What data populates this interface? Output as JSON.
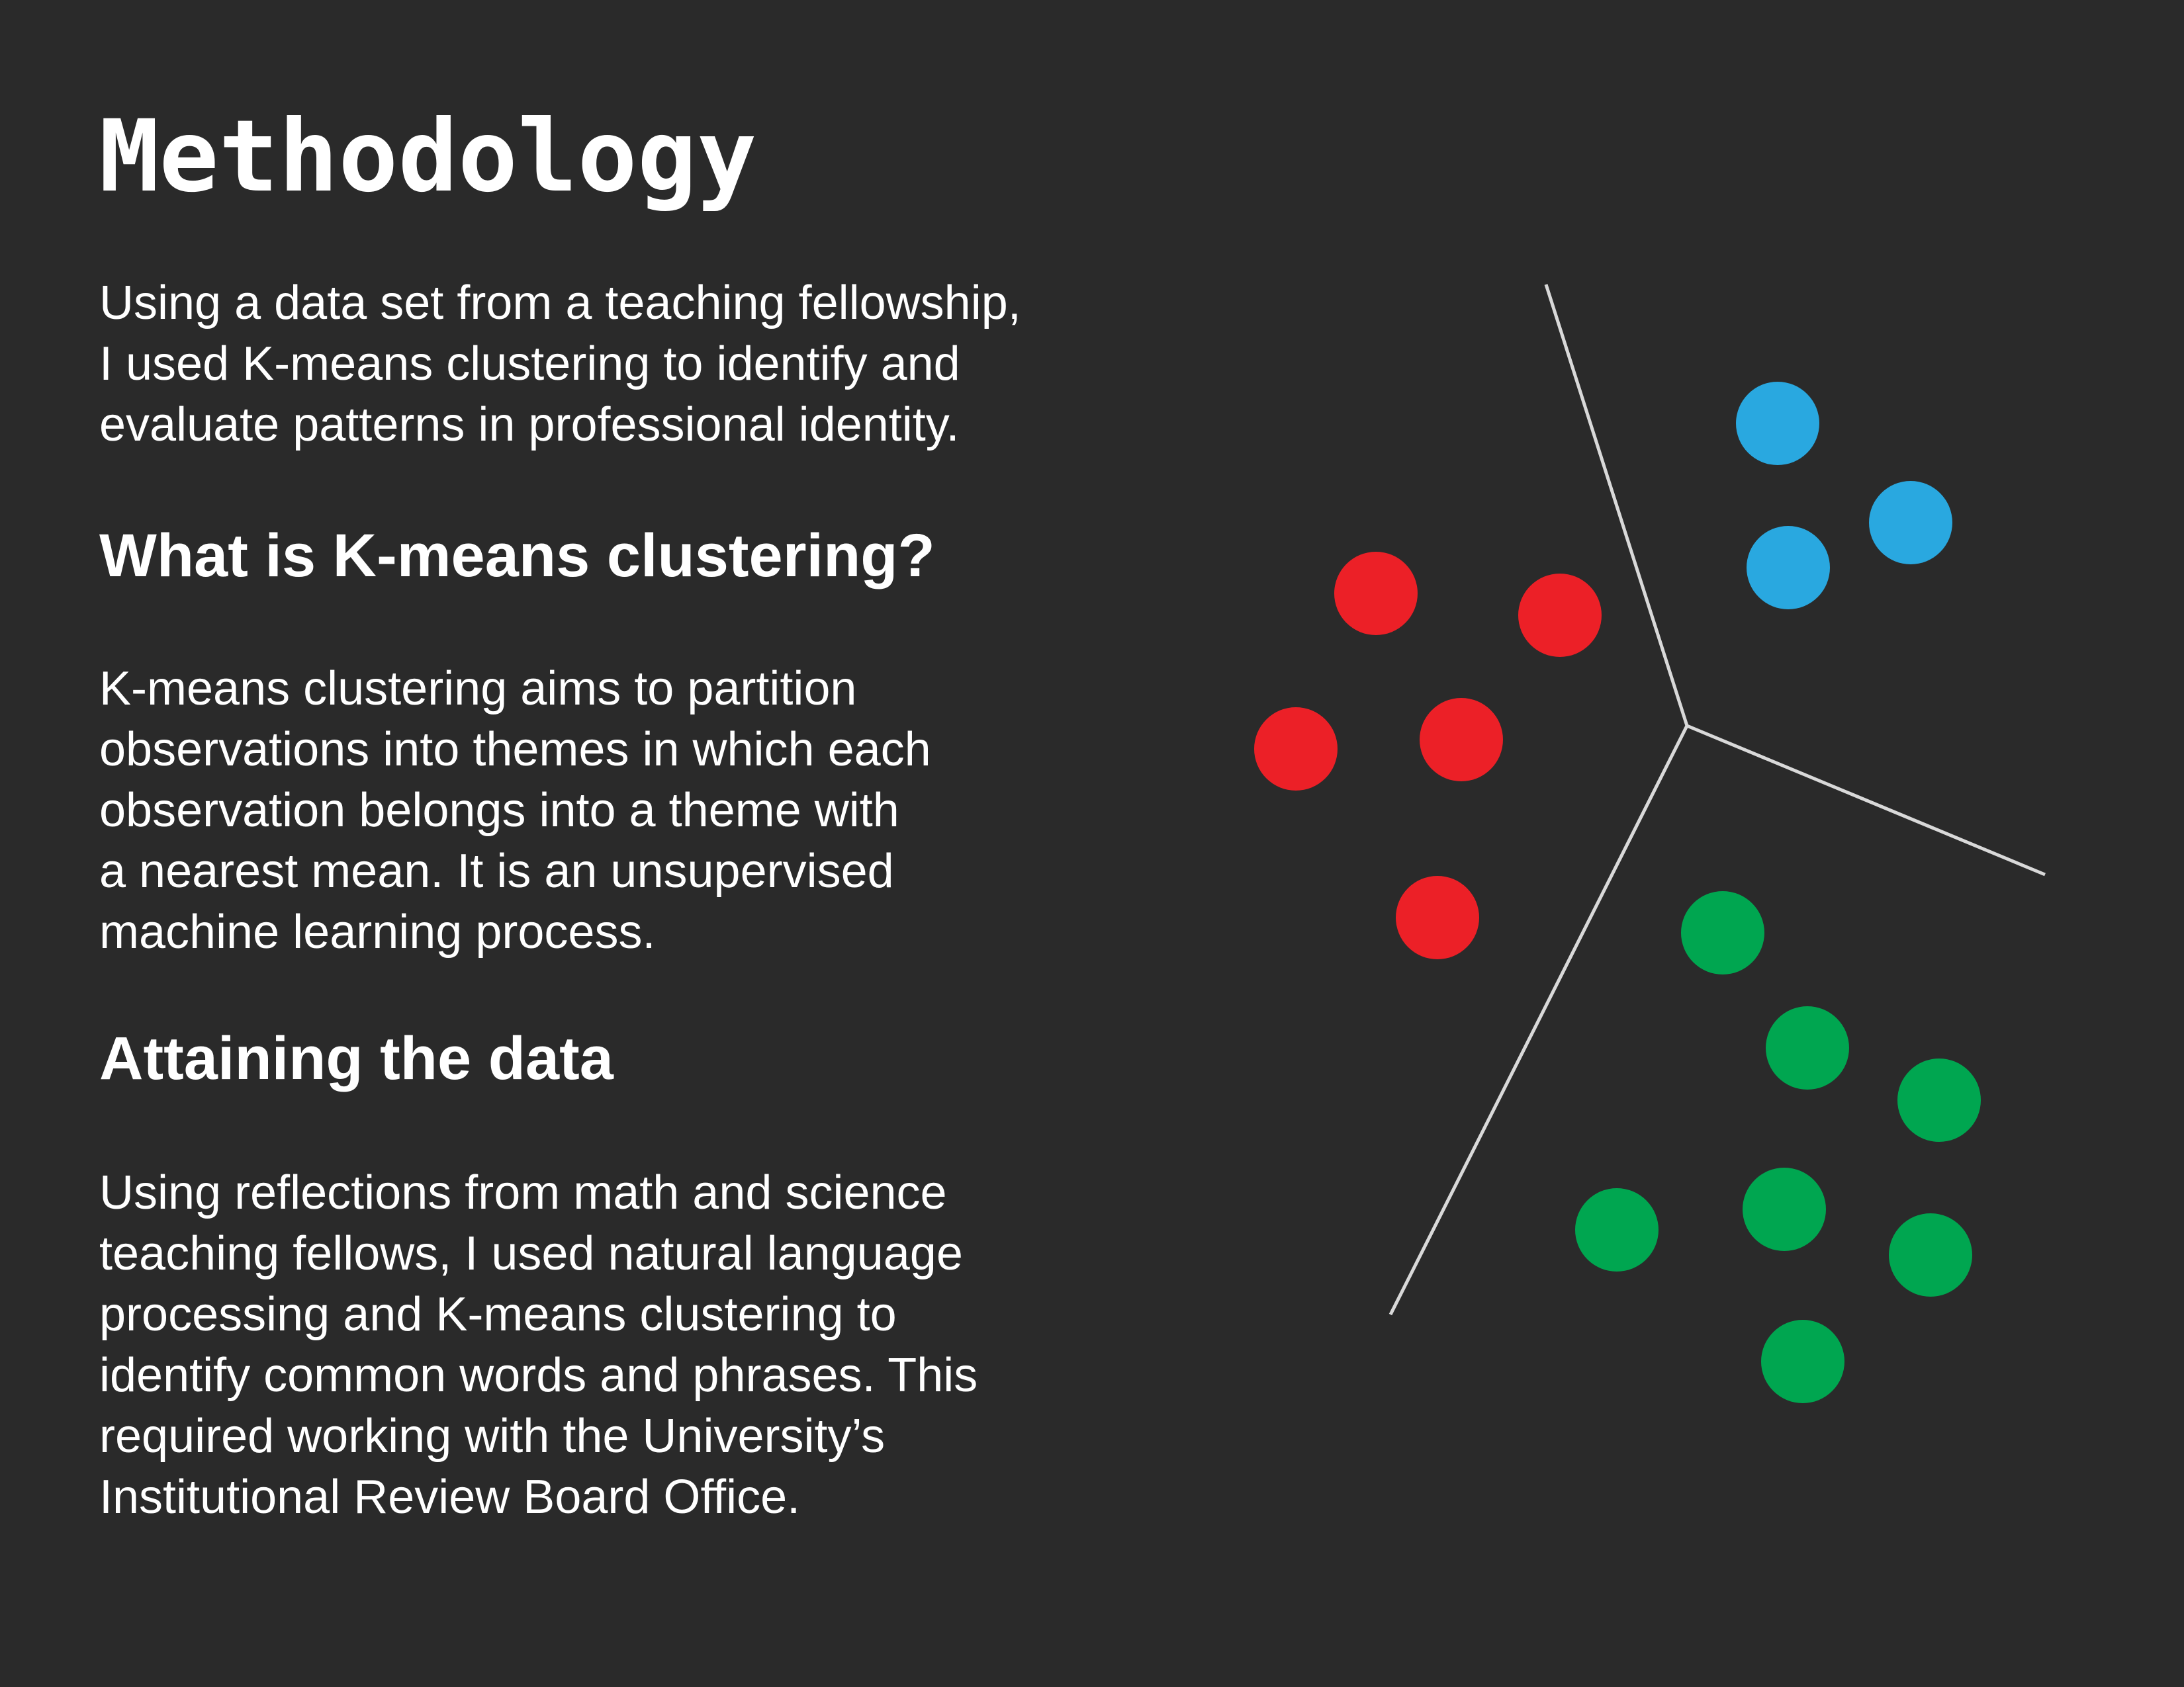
{
  "title": "Methodology",
  "intro": "Using a data set from a teaching fellowship,\nI used K-means clustering to identify and\nevaluate patterns in professional identity.",
  "section_kmeans": {
    "heading": "What is K-means clustering?",
    "body": "K-means clustering aims to partition\nobservations  into themes in which each\nobservation belongs into a theme with\na nearest mean.  It is an unsupervised\nmachine learning process."
  },
  "section_data": {
    "heading": "Attaining the data",
    "body": "Using reflections from math and science\nteaching fellows, I used natural language\nprocessing and K-means clustering to\nidentify common words and phrases. This\nrequired working with the University’s\nInstitutional Review Board Office."
  },
  "colors": {
    "background": "#2a2a2a",
    "text": "#ffffff",
    "divider_line": "#d9d9d9",
    "cluster_blue": "#29a8e0",
    "cluster_red": "#ec2027",
    "cluster_green": "#00a650"
  }
}
